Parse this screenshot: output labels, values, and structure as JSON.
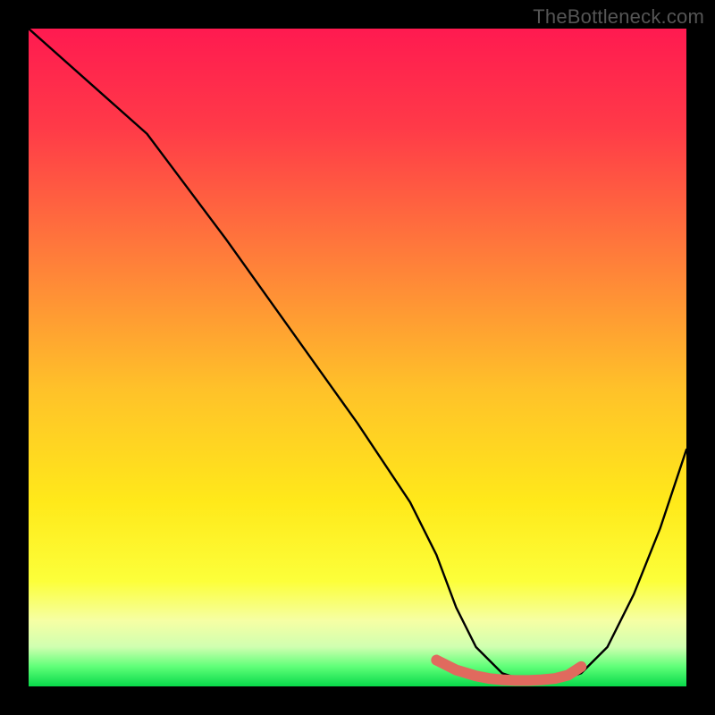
{
  "watermark": "TheBottleneck.com",
  "chart_data": {
    "type": "line",
    "title": "",
    "xlabel": "",
    "ylabel": "",
    "xlim": [
      0,
      100
    ],
    "ylim": [
      0,
      100
    ],
    "grid": false,
    "legend": false,
    "gradient_stops": [
      {
        "offset": 0,
        "color": "#ff1a50"
      },
      {
        "offset": 0.15,
        "color": "#ff3a48"
      },
      {
        "offset": 0.35,
        "color": "#ff7e3a"
      },
      {
        "offset": 0.55,
        "color": "#ffc229"
      },
      {
        "offset": 0.72,
        "color": "#ffe91a"
      },
      {
        "offset": 0.84,
        "color": "#fcff3a"
      },
      {
        "offset": 0.9,
        "color": "#f6ffa4"
      },
      {
        "offset": 0.94,
        "color": "#d0ffb0"
      },
      {
        "offset": 0.97,
        "color": "#5fff78"
      },
      {
        "offset": 1.0,
        "color": "#08d94a"
      }
    ],
    "series": [
      {
        "name": "bottleneck-curve",
        "x": [
          0,
          18,
          21,
          30,
          40,
          50,
          58,
          62,
          65,
          68,
          72,
          75,
          78,
          81,
          84,
          88,
          92,
          96,
          100
        ],
        "y": [
          100,
          84,
          80,
          68,
          54,
          40,
          28,
          20,
          12,
          6,
          2,
          1,
          1,
          1,
          2,
          6,
          14,
          24,
          36
        ]
      }
    ],
    "highlight_segment": {
      "name": "optimal-range-marker",
      "color": "#e06a5e",
      "thickness": 12,
      "x": [
        62,
        65,
        68,
        70,
        72,
        74,
        76,
        78,
        80,
        82,
        84
      ],
      "y": [
        4,
        2.5,
        1.6,
        1.2,
        1.0,
        0.9,
        0.9,
        1.0,
        1.2,
        1.7,
        3.0
      ]
    }
  }
}
